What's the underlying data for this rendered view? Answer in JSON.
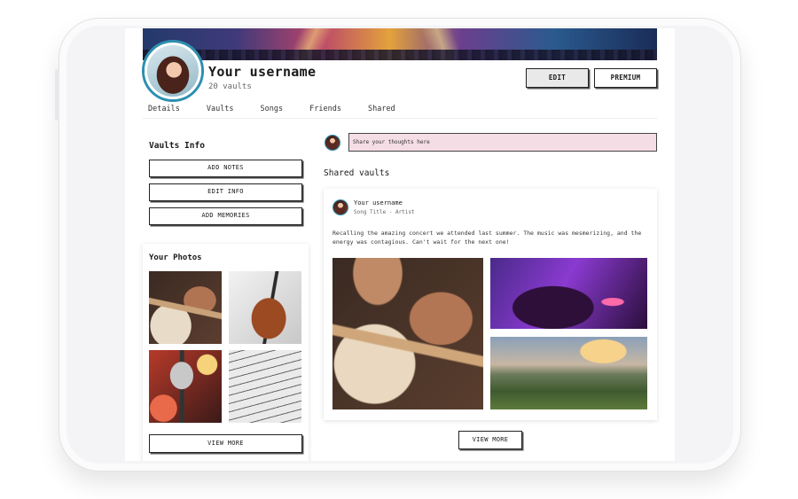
{
  "profile": {
    "username": "Your username",
    "vault_count": "20 vaults",
    "edit_label": "EDIT",
    "premium_label": "PREMIUM"
  },
  "tabs": [
    {
      "label": "Details"
    },
    {
      "label": "Vaults"
    },
    {
      "label": "Songs"
    },
    {
      "label": "Friends"
    },
    {
      "label": "Shared"
    }
  ],
  "sidebar": {
    "vaults_info_title": "Vaults Info",
    "add_notes_label": "ADD NOTES",
    "edit_info_label": "EDIT INFO",
    "add_memories_label": "ADD MEMORIES",
    "photos_title": "Your Photos",
    "photos_view_more_label": "VIEW MORE"
  },
  "composer": {
    "placeholder": "Share your thoughts here"
  },
  "feed": {
    "title": "Shared vaults",
    "post": {
      "user": "Your username",
      "song": "Song Title - Artist",
      "text": "Recalling the amazing concert we attended last summer. The music was mesmerizing, and the energy was contagious. Can't wait for the next one!"
    },
    "view_more_label": "VIEW MORE"
  },
  "colors": {
    "composer_bg": "#f5dde6",
    "avatar_ring": "#2c8fb0",
    "edit_button_bg": "#e9e9e9"
  }
}
